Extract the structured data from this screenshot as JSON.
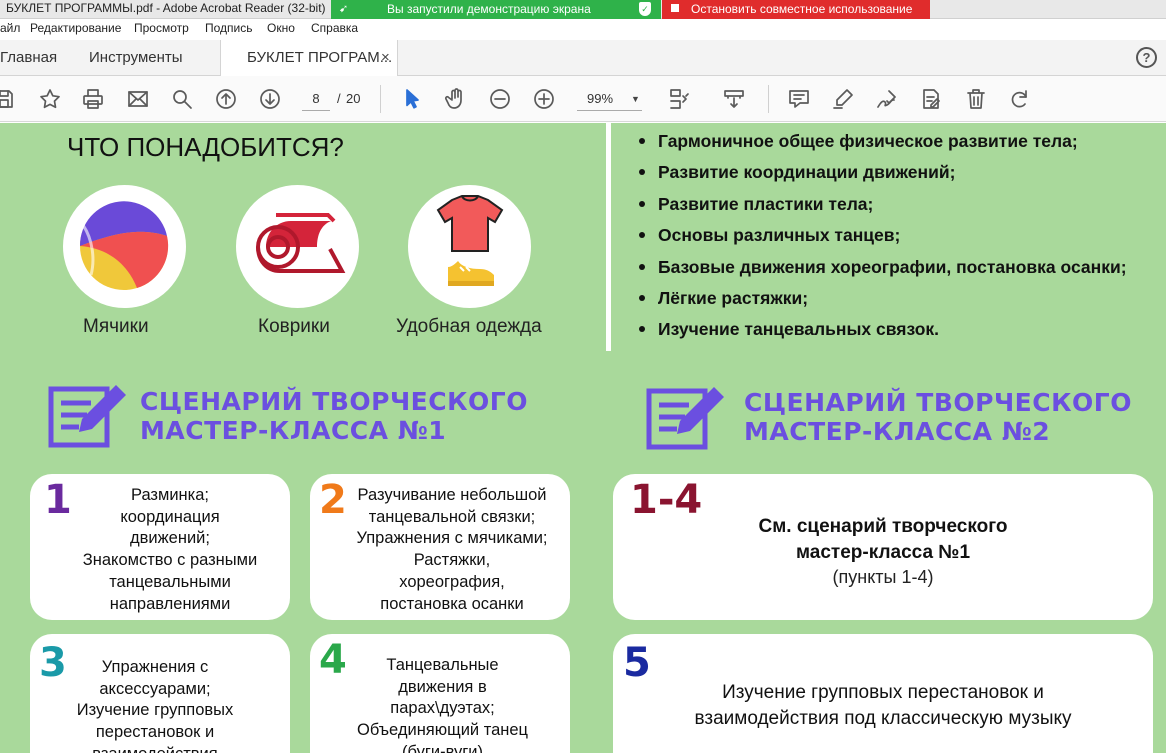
{
  "app": {
    "title": "БУКЛЕТ ПРОГРАММЫ.pdf - Adobe Acrobat Reader (32-bit)",
    "share_notice": "Вы запустили демонстрацию экрана",
    "stop_share": "Остановить совместное использование",
    "colors": {
      "share_green": "#2fb24a",
      "share_red": "#e02c2c"
    }
  },
  "menu": [
    "айл",
    "Редактирование",
    "Просмотр",
    "Подпись",
    "Окно",
    "Справка"
  ],
  "tabs": {
    "home": "Главная",
    "tools": "Инструменты",
    "doc": "БУКЛЕТ ПРОГРАМ...",
    "close": "×",
    "help": "?"
  },
  "toolbar": {
    "page_current": "8",
    "page_sep": "/",
    "page_total": "20",
    "zoom": "99%",
    "icons": [
      "save-icon",
      "bookmark-star-icon",
      "print-icon",
      "email-icon",
      "zoom-search-icon",
      "page-up-icon",
      "page-down-icon",
      "select-cursor-icon",
      "hand-icon",
      "zoom-out-icon",
      "zoom-in-icon",
      "page-fit-icon",
      "scroll-mode-icon",
      "comment-icon",
      "highlight-icon",
      "sign-icon",
      "edit-pdf-icon",
      "delete-icon",
      "rotate-icon"
    ]
  },
  "doc": {
    "bg": "#a9d99b",
    "need_title": "ЧТО ПОНАДОБИТСЯ?",
    "items": [
      "Мячики",
      "Коврики",
      "Удобная одежда"
    ],
    "bullets": [
      "Гармоничное общее физическое развитие тела;",
      "Развитие координации движений;",
      "Развитие пластики тела;",
      "Основы различных танцев;",
      "Базовые движения хореографии, постановка осанки;",
      "Лёгкие растяжки;",
      "Изучение танцевальных связок."
    ],
    "scenario1": "СЦЕНАРИЙ ТВОРЧЕСКОГО\nМАСТЕР-КЛАССА №1",
    "scenario2": "СЦЕНАРИЙ ТВОРЧЕСКОГО\nМАСТЕР-КЛАССА №2",
    "scenario_color": "#6b4fe0",
    "cards1": [
      {
        "num": "1",
        "color": "#6a2a9e",
        "text": "Разминка;\nкоординация\nдвижений;\nЗнакомство с разными\nтанцевальными\nнаправлениями"
      },
      {
        "num": "2",
        "color": "#f07a1a",
        "text": "Разучивание небольшой\nтанцевальной связки;\nУпражнения с мячиками;\nРастяжки,\nхореография,\nпостановка осанки"
      },
      {
        "num": "3",
        "color": "#1a9aa8",
        "text": "Упражнения с\nаксессуарами;\nИзучение групповых\nперестановок и\nвзаимодействия"
      },
      {
        "num": "4",
        "color": "#2aa84a",
        "text": "Танцевальные\nдвижения в\nпарах\\дуэтах;\nОбъединяющий танец\n(буги-вуги)"
      }
    ],
    "cards2": [
      {
        "num": "1-4",
        "color": "#8a1430",
        "title": "См. сценарий творческого\nмастер-класса №1",
        "sub": "(пункты 1-4)"
      },
      {
        "num": "5",
        "color": "#1a2aa0",
        "text": "Изучение групповых перестановок и\nвзаимодействия под классическую музыку"
      }
    ]
  }
}
